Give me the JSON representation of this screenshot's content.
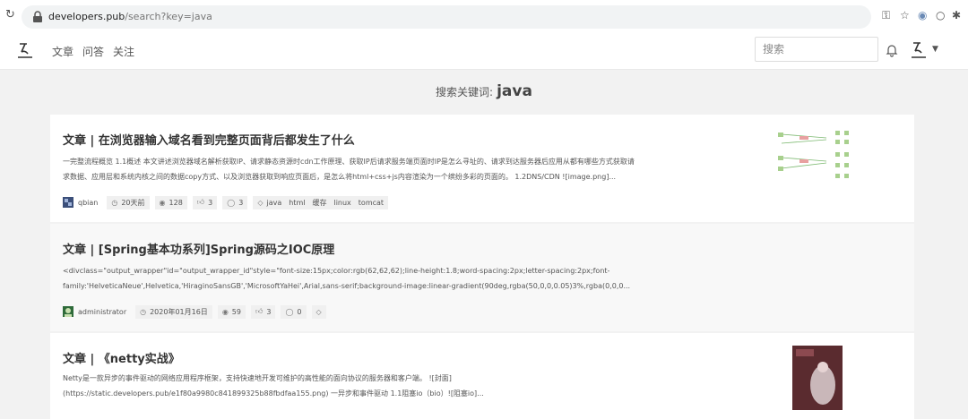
{
  "browser": {
    "url_host": "developers.pub",
    "url_path": "/search?key=java"
  },
  "header": {
    "nav": [
      "文章",
      "问答",
      "关注"
    ],
    "search_placeholder": "搜索"
  },
  "search": {
    "label": "搜索关键词:",
    "keyword": "java"
  },
  "results": [
    {
      "title": "文章 | 在浏览器输入域名看到完整页面背后都发生了什么",
      "snippet_lines": [
        "一完整流程概览 1.1概述 本文讲述浏览器域名解析获取IP、请求静态资源时cdn工作原理、获取IP后请求服务端页面时IP是怎么寻址的、请求到达服务器后应用从都有哪些方式获取请",
        "求数据、应用层和系统内核之间的数据copy方式、以及浏览器获取到响应页面后，是怎么将html+css+js内容渲染为一个缤纷多彩的页面的。 1.2DNS/CDN ![image.png]..."
      ],
      "author": "qbian",
      "time": "20天前",
      "views": "128",
      "likes": "3",
      "comments": "3",
      "tags": [
        "java",
        "html",
        "缓存",
        "linux",
        "tomcat"
      ]
    },
    {
      "title": "文章 | [Spring基本功系列]Spring源码之IOC原理",
      "snippet_lines": [
        "<divclass=\"output_wrapper\"id=\"output_wrapper_id\"style=\"font-size:15px;color:rgb(62,62,62);line-height:1.8;word-spacing:2px;letter-spacing:2px;font-",
        "family:'HelveticaNeue',Helvetica,'HiraginoSansGB','MicrosoftYaHei',Arial,sans-serif;background-image:linear-gradient(90deg,rgba(50,0,0,0.05)3%,rgba(0,0,0..."
      ],
      "author": "administrator",
      "time": "2020年01月16日",
      "views": "59",
      "likes": "3",
      "comments": "0"
    },
    {
      "title": "文章 | 《netty实战》",
      "snippet_lines": [
        "Netty是一款异步的事件驱动的网络应用程序框架，支持快速地开发可维护的高性能的面向协议的服务器和客户端。 ![封面]",
        "(https://static.developers.pub/e1f80a9980c841899325b88fbdfaa155.png) 一异步和事件驱动 1.1阻塞io（bio）![阻塞io]..."
      ]
    }
  ],
  "icons": {
    "clock": "clock-icon",
    "eye": "eye-icon",
    "like": "thumbs-up-icon",
    "comment": "comment-icon",
    "tag": "tag-icon"
  },
  "colors": {
    "page_bg": "#f2f2f2",
    "card_bg": "#ffffff",
    "title": "#333333"
  }
}
